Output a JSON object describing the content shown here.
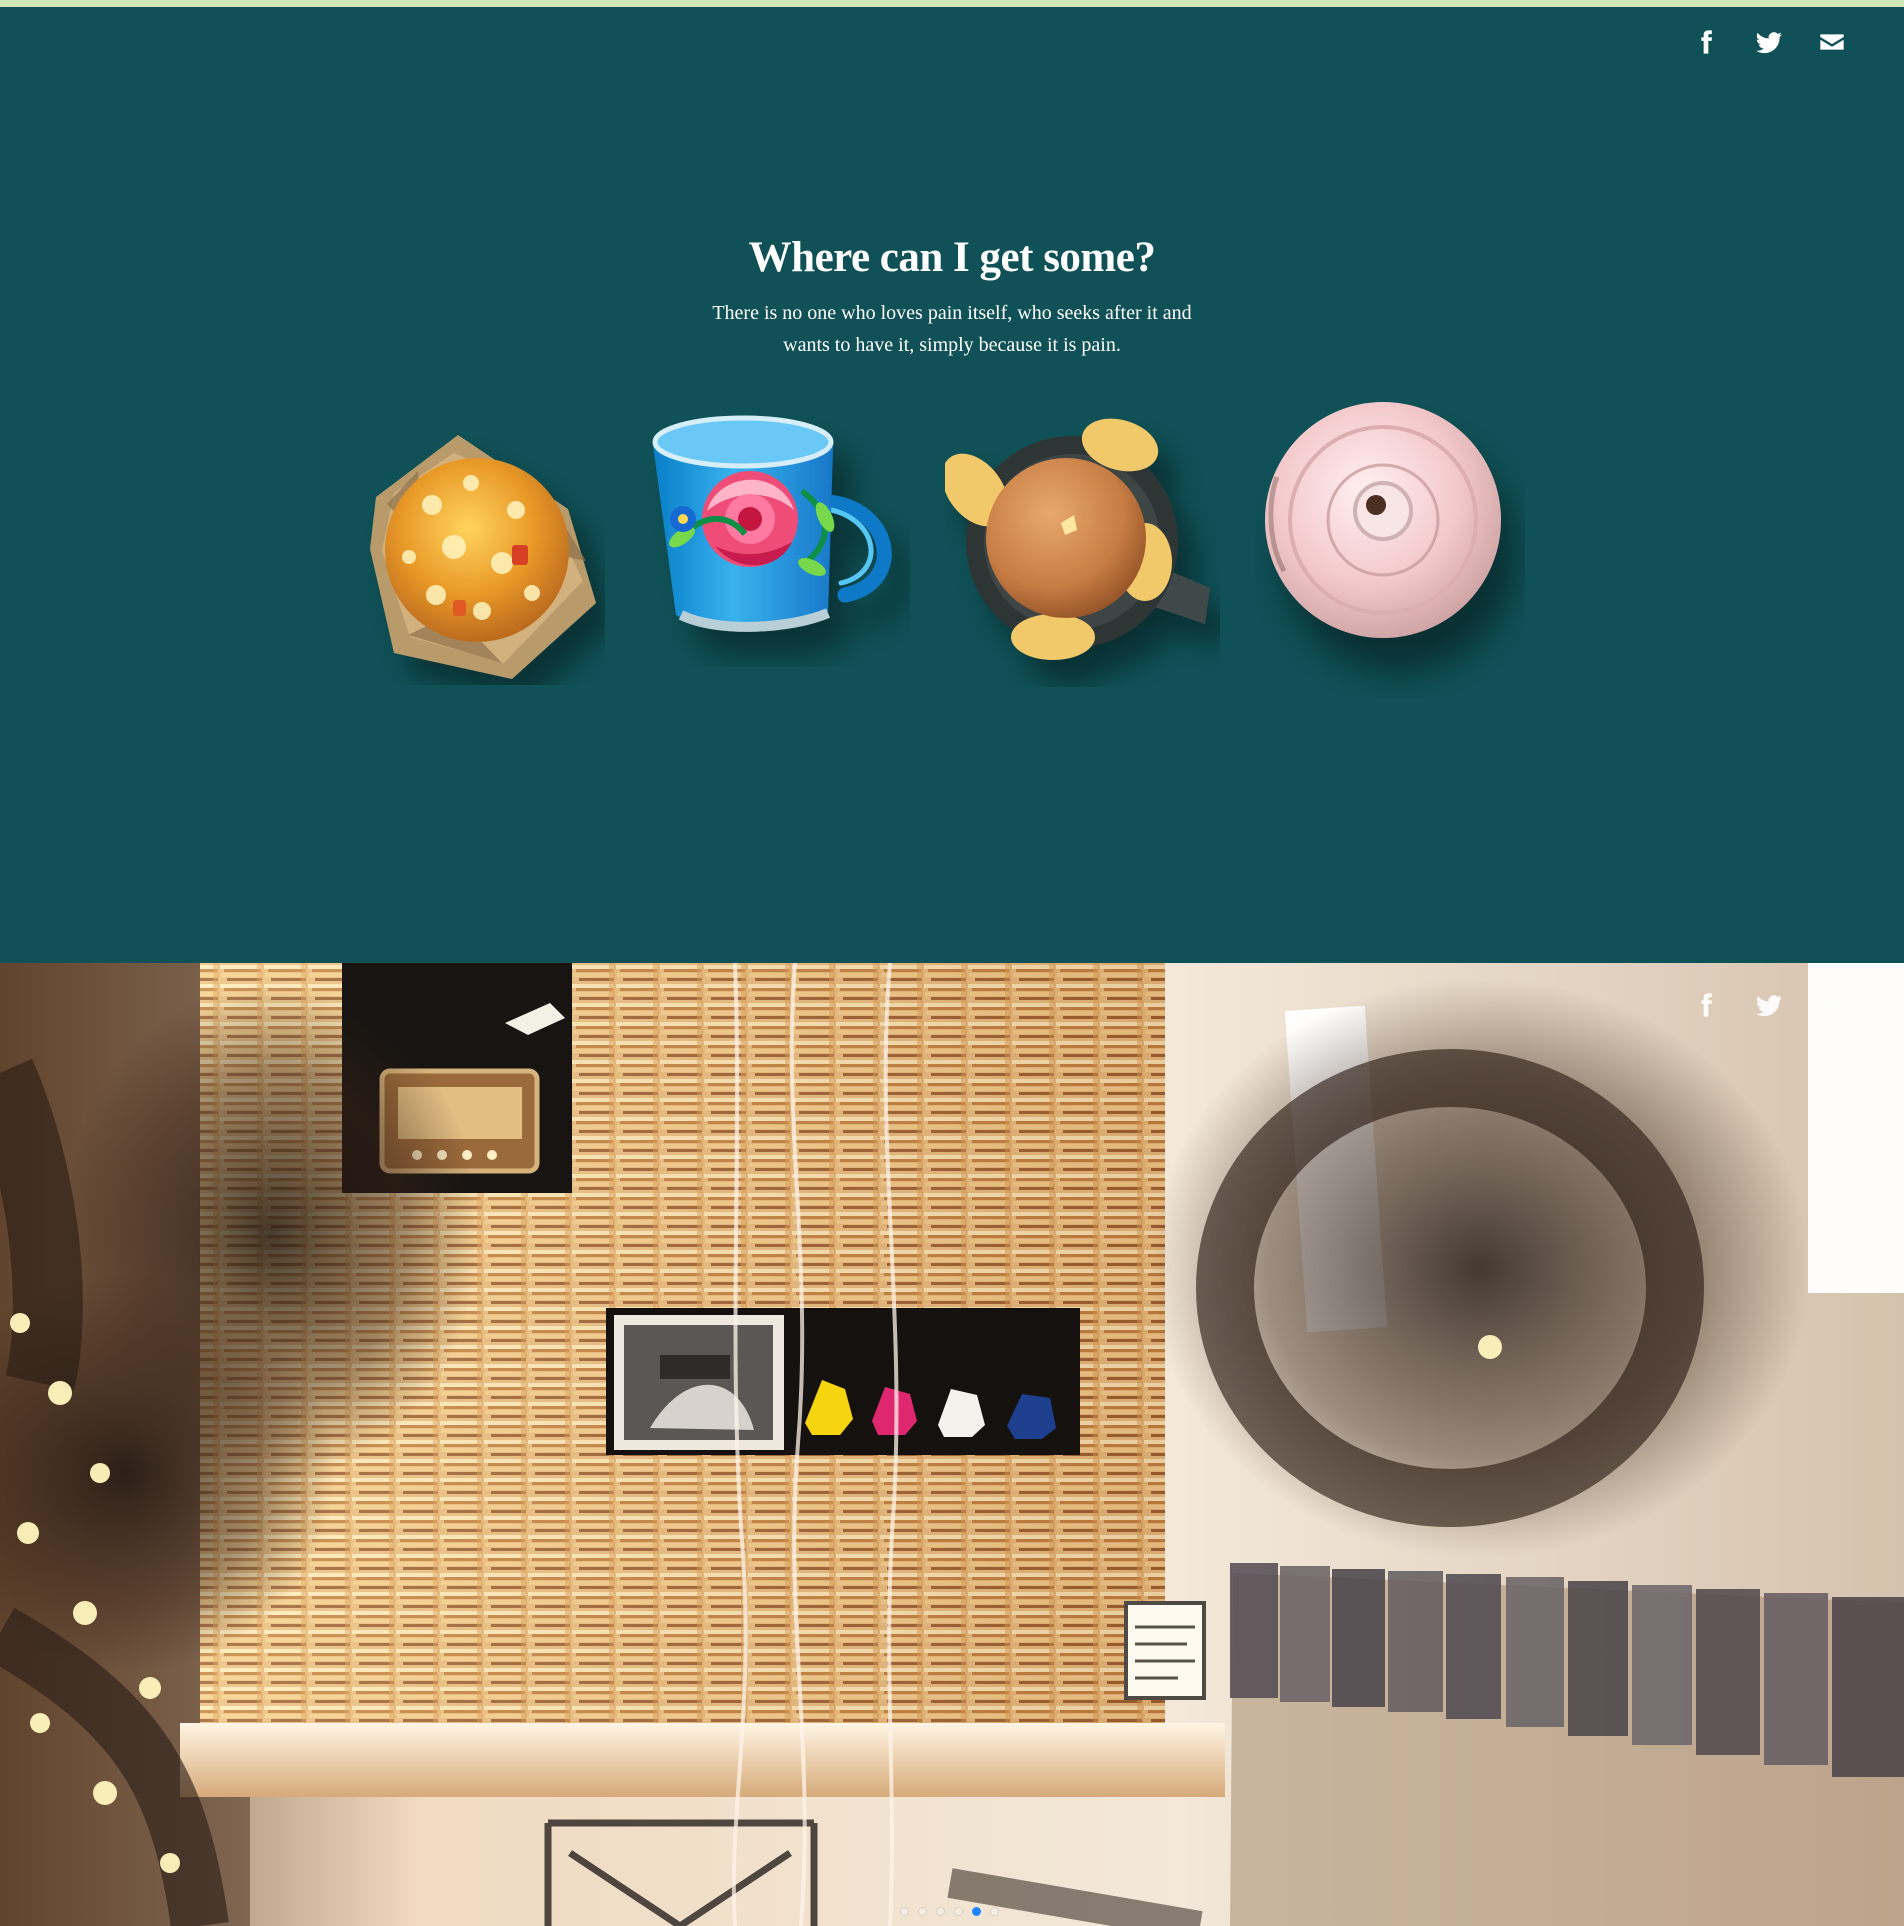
{
  "hero": {
    "title": "Where can I get some?",
    "body": "There is no one who loves pain itself, who seeks after it and wants to have it, simply because it is pain."
  },
  "social_icons": [
    "facebook-icon",
    "twitter-icon",
    "email-icon"
  ],
  "hero_images": [
    "muffin-icon",
    "flower-mug-icon",
    "tart-icon",
    "sugar-bowl-icon"
  ],
  "gallery": {
    "active_slide": 5,
    "slide_count": 6
  },
  "colors": {
    "top_line": "#cfe7b7",
    "hero_background": "#0f5156",
    "text": "#ffffff",
    "active_dot": "#1c84ff"
  }
}
